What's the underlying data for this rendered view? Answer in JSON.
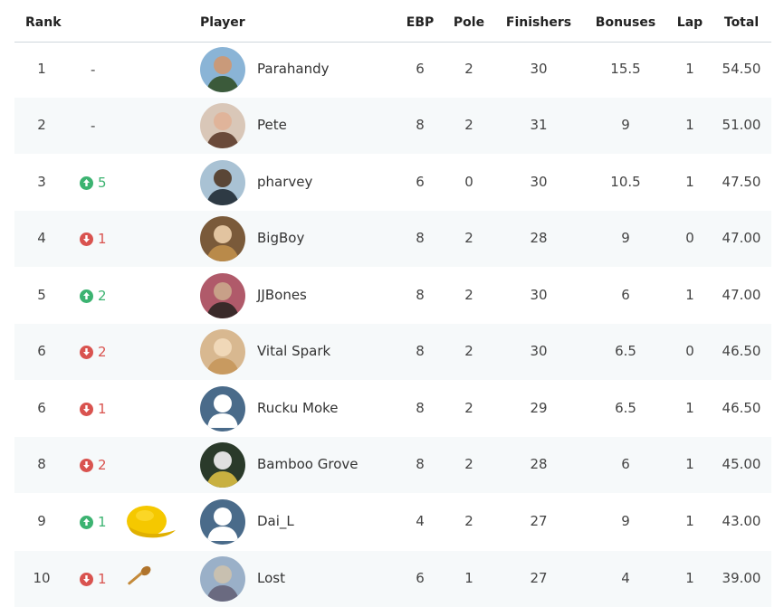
{
  "headers": {
    "rank": "Rank",
    "player": "Player",
    "ebp": "EBP",
    "pole": "Pole",
    "finishers": "Finishers",
    "bonuses": "Bonuses",
    "lap": "Lap",
    "total": "Total"
  },
  "rows": [
    {
      "rank": "1",
      "change": "-",
      "dir": "none",
      "name": "Parahandy",
      "ebp": "6",
      "pole": "2",
      "finishers": "30",
      "bonuses": "15.5",
      "lap": "1",
      "total": "54.50",
      "avatar": "photo"
    },
    {
      "rank": "2",
      "change": "-",
      "dir": "none",
      "name": "Pete",
      "ebp": "8",
      "pole": "2",
      "finishers": "31",
      "bonuses": "9",
      "lap": "1",
      "total": "51.00",
      "avatar": "photo"
    },
    {
      "rank": "3",
      "change": "5",
      "dir": "up",
      "name": "pharvey",
      "ebp": "6",
      "pole": "0",
      "finishers": "30",
      "bonuses": "10.5",
      "lap": "1",
      "total": "47.50",
      "avatar": "photo"
    },
    {
      "rank": "4",
      "change": "1",
      "dir": "down",
      "name": "BigBoy",
      "ebp": "8",
      "pole": "2",
      "finishers": "28",
      "bonuses": "9",
      "lap": "0",
      "total": "47.00",
      "avatar": "photo"
    },
    {
      "rank": "5",
      "change": "2",
      "dir": "up",
      "name": "JJBones",
      "ebp": "8",
      "pole": "2",
      "finishers": "30",
      "bonuses": "6",
      "lap": "1",
      "total": "47.00",
      "avatar": "photo"
    },
    {
      "rank": "6",
      "change": "2",
      "dir": "down",
      "name": "Vital Spark",
      "ebp": "8",
      "pole": "2",
      "finishers": "30",
      "bonuses": "6.5",
      "lap": "0",
      "total": "46.50",
      "avatar": "photo"
    },
    {
      "rank": "6",
      "change": "1",
      "dir": "down",
      "name": "Rucku Moke",
      "ebp": "8",
      "pole": "2",
      "finishers": "29",
      "bonuses": "6.5",
      "lap": "1",
      "total": "46.50",
      "avatar": "default"
    },
    {
      "rank": "8",
      "change": "2",
      "dir": "down",
      "name": "Bamboo Grove",
      "ebp": "8",
      "pole": "2",
      "finishers": "28",
      "bonuses": "6",
      "lap": "1",
      "total": "45.00",
      "avatar": "photo"
    },
    {
      "rank": "9",
      "change": "1",
      "dir": "up",
      "name": "Dai_L",
      "ebp": "4",
      "pole": "2",
      "finishers": "27",
      "bonuses": "9",
      "lap": "1",
      "total": "43.00",
      "avatar": "default",
      "badge": "yellow-cap-icon"
    },
    {
      "rank": "10",
      "change": "1",
      "dir": "down",
      "name": "Lost",
      "ebp": "6",
      "pole": "1",
      "finishers": "27",
      "bonuses": "4",
      "lap": "1",
      "total": "39.00",
      "avatar": "photo",
      "badge": "wooden-spoon-icon"
    }
  ],
  "colors": {
    "up": "#3cb371",
    "down": "#d9534f",
    "avatar_default": "#4a6b8a",
    "row_alt": "#f6f9fa"
  }
}
